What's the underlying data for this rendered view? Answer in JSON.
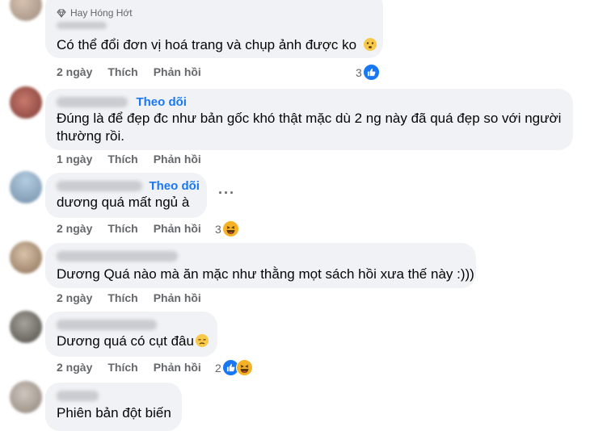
{
  "comments": [
    {
      "badge": "Hay Hóng Hớt",
      "text": "Có thể đổi đơn vị hoá trang và chụp ảnh được ko",
      "time": "2 ngày",
      "like": "Thích",
      "reply": "Phản hồi",
      "reaction_count": "3",
      "reactions": [
        "like-icon"
      ]
    },
    {
      "follow": "Theo dõi",
      "text_line1": "Đúng là để đẹp đc như bản gốc khó thật mặc dù 2 ng này đã quá đẹp so với người",
      "text_line2": "thường rồi.",
      "time": "1 ngày",
      "like": "Thích",
      "reply": "Phản hồi"
    },
    {
      "follow": "Theo dõi",
      "text": "dương quá mất ngủ à",
      "more": "···",
      "time": "2 ngày",
      "like": "Thích",
      "reply": "Phản hồi",
      "reaction_count": "3",
      "reactions": [
        "haha-icon"
      ]
    },
    {
      "text": "Dương Quá nào mà ăn mặc như thằng mọt sách hồi xưa thế này :)))",
      "time": "2 ngày",
      "like": "Thích",
      "reply": "Phản hồi"
    },
    {
      "text": "Dương quá có cụt đâu",
      "time": "2 ngày",
      "like": "Thích",
      "reply": "Phản hồi",
      "reaction_count": "2",
      "reactions": [
        "like-icon",
        "haha-icon"
      ]
    },
    {
      "text": "Phiên bản đột biến"
    }
  ],
  "colors": {
    "bubble": "#f0f2f5",
    "meta": "#65676b",
    "link": "#1877f2"
  }
}
